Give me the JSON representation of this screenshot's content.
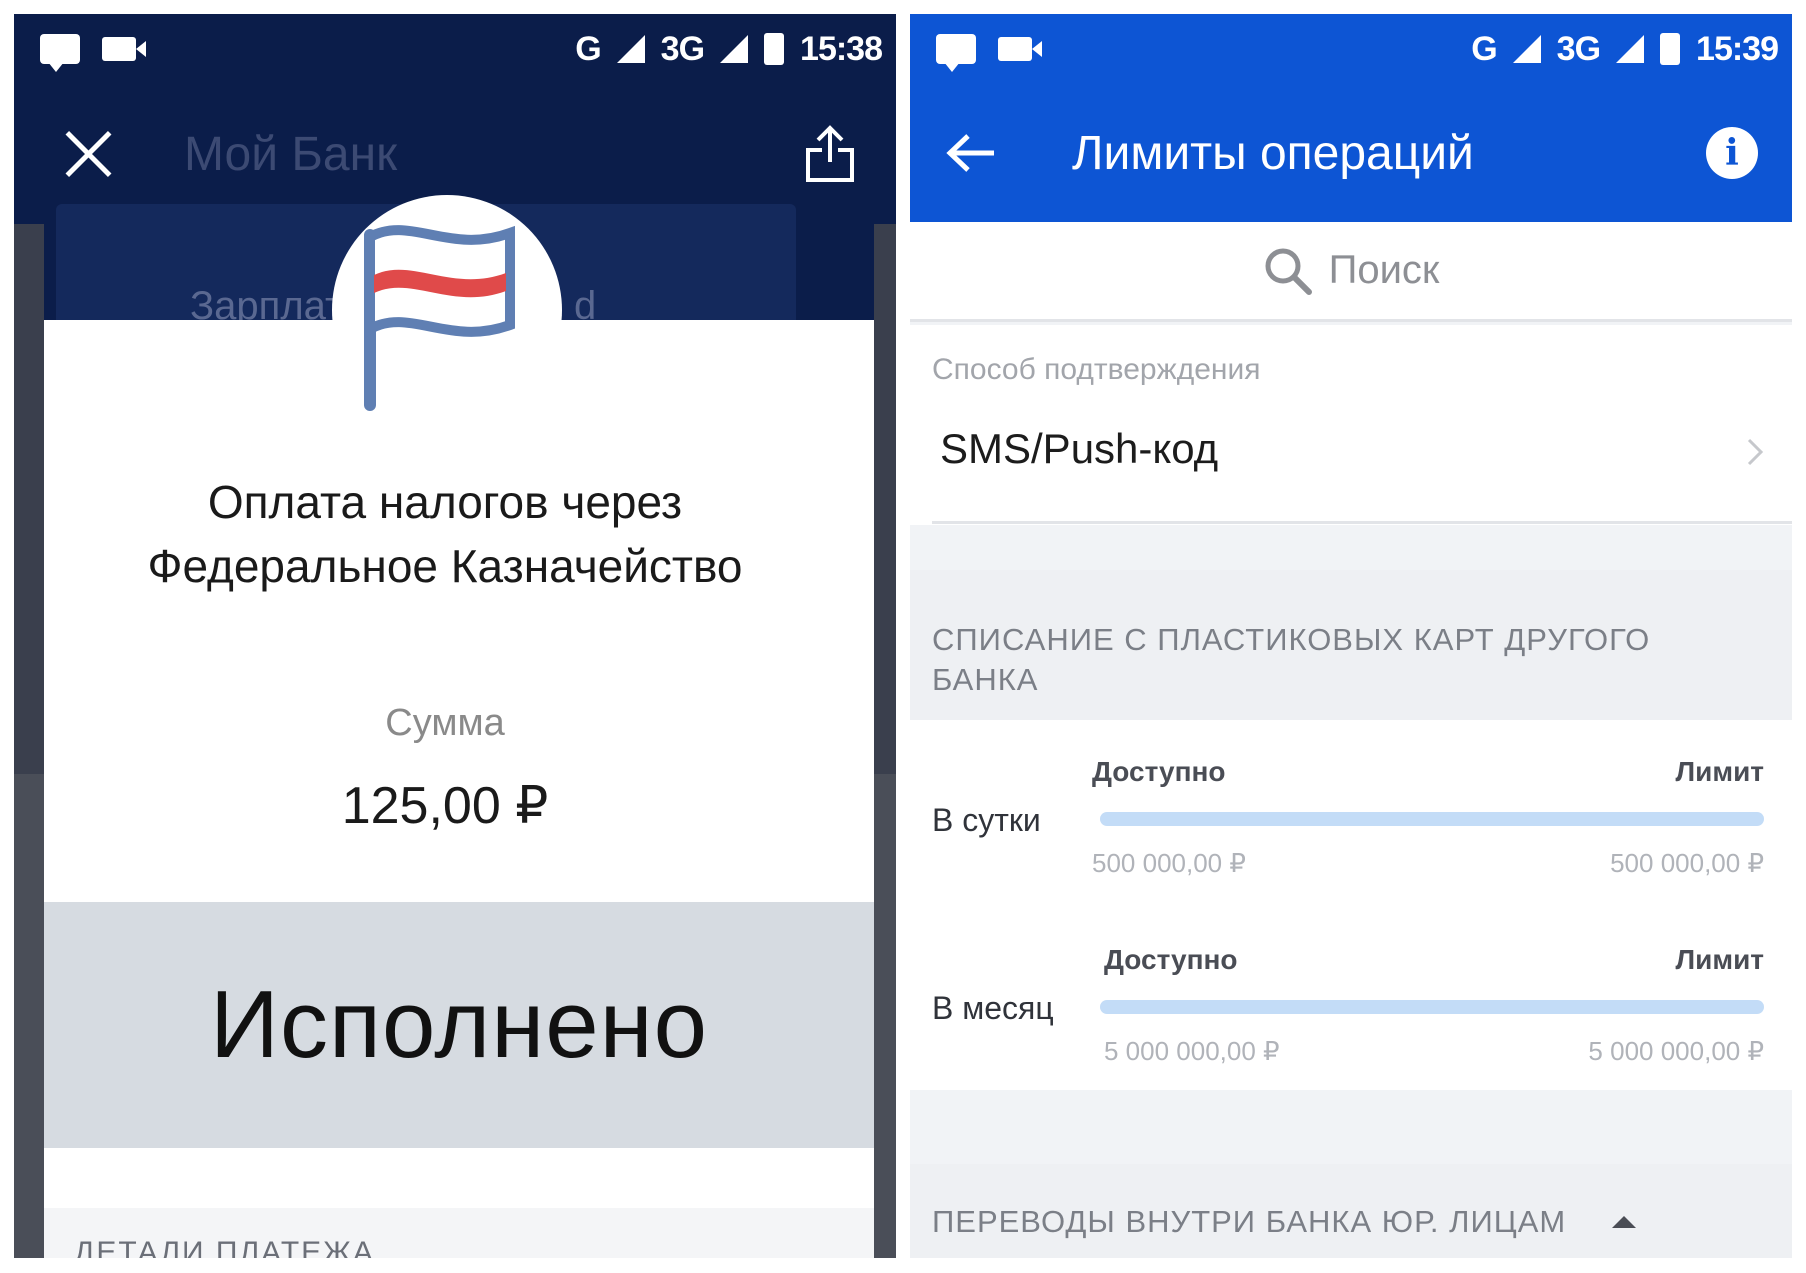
{
  "left_screen": {
    "status_bar": {
      "network": "G",
      "network2": "3G",
      "time": "15:38"
    },
    "app_bar": {
      "title": "Мой Банк"
    },
    "background_card": {
      "label": "Зарплат",
      "label_tail": "d"
    },
    "modal": {
      "title_line1": "Оплата налогов через",
      "title_line2": "Федеральное Казначейство",
      "sum_label": "Сумма",
      "sum_value": "125,00 ₽",
      "status": "Исполнено",
      "details_label": "ДЕТАЛИ ПЛАТЕЖА"
    },
    "flag_colors": {
      "outline": "#5f7fb3",
      "stripe": "#e04a4a"
    }
  },
  "right_screen": {
    "status_bar": {
      "network": "G",
      "network2": "3G",
      "time": "15:39"
    },
    "app_bar": {
      "title": "Лимиты операций",
      "info": "i"
    },
    "search": {
      "placeholder": "Поиск"
    },
    "confirmation": {
      "label": "Способ подтверждения",
      "value": "SMS/Push-код"
    },
    "section1": {
      "title": "СПИСАНИЕ С ПЛАСТИКОВЫХ КАРТ ДРУГОГО БАНКА"
    },
    "limits": [
      {
        "period": "В сутки",
        "available_label": "Доступно",
        "limit_label": "Лимит",
        "available_value": "500 000,00 ₽",
        "limit_value": "500 000,00 ₽",
        "available_fraction": 1.0
      },
      {
        "period": "В месяц",
        "available_label": "Доступно",
        "limit_label": "Лимит",
        "available_value": "5 000 000,00 ₽",
        "limit_value": "5 000 000,00 ₽",
        "available_fraction": 1.0
      }
    ],
    "section2": {
      "title": "ПЕРЕВОДЫ ВНУТРИ БАНКА ЮР. ЛИЦАМ"
    },
    "colors": {
      "primary": "#0d55d4",
      "bar": "#c3dcf7"
    }
  }
}
